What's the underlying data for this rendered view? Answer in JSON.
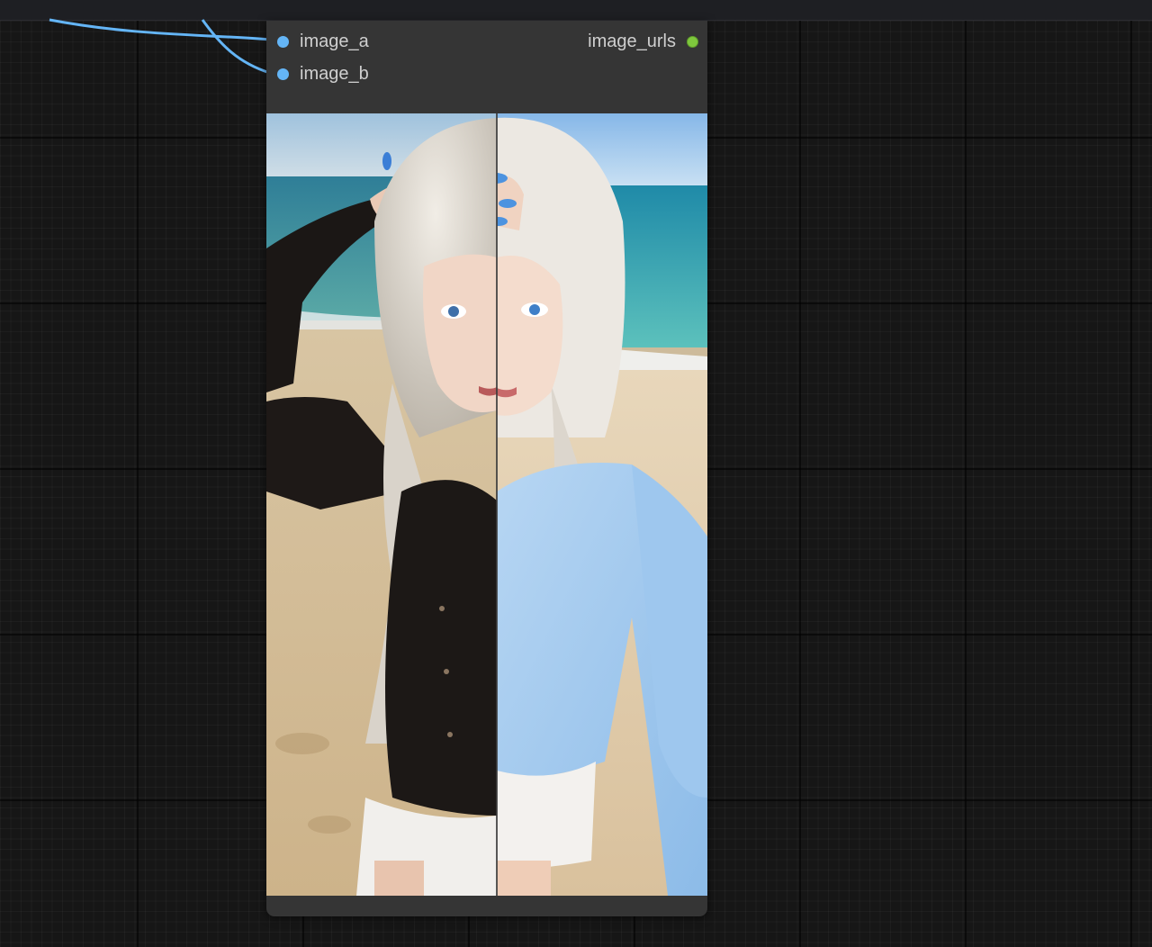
{
  "node": {
    "inputs": [
      {
        "label": "image_a",
        "color": "#64b5f6"
      },
      {
        "label": "image_b",
        "color": "#64b5f6"
      }
    ],
    "outputs": [
      {
        "label": "image_urls",
        "color": "#7ec73d"
      }
    ],
    "preview": {
      "left_image": "image_a",
      "right_image": "image_b",
      "split_fraction": 0.52
    }
  },
  "colors": {
    "canvas": "#161616",
    "node_body": "#353535",
    "link": "#64b5f6"
  }
}
